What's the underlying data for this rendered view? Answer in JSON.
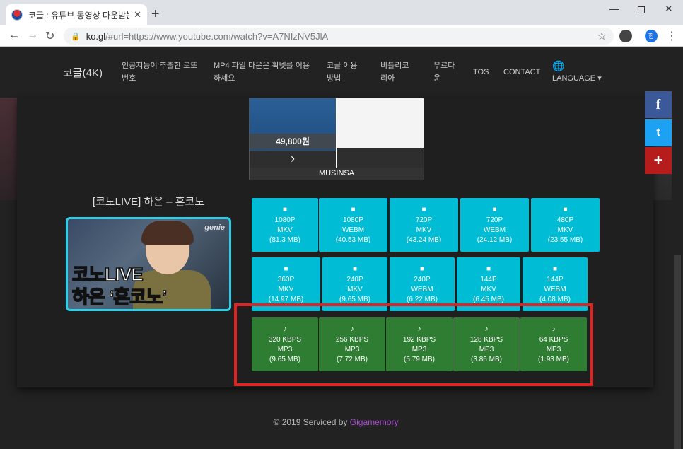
{
  "browser": {
    "tab_title": "코글 : 유튜브 동영상 다운받는법",
    "tab_close": "✕",
    "new_tab": "+",
    "url_host": "ko.gl",
    "url_rest": "/#url=https://www.youtube.com/watch?v=A7NIzNV5JlA",
    "ext_label": "한"
  },
  "nav": {
    "brand": "코글(4K)",
    "items": [
      {
        "line1": "인공지능이 추출한 로또",
        "line2": "번호"
      },
      {
        "line1": "MP4 파일 다운은 휙넷를 이용",
        "line2": "하세요"
      },
      {
        "line1": "코글 이용",
        "line2": "방법"
      },
      {
        "line1": "비틀리코",
        "line2": "리아"
      },
      {
        "line1": "무료다",
        "line2": "운"
      },
      {
        "line1": "TOS",
        "line2": ""
      },
      {
        "line1": "CONTACT",
        "line2": ""
      }
    ],
    "language": "LANGUAGE"
  },
  "ad": {
    "price": "49,800원",
    "footer": "MUSINSA"
  },
  "video": {
    "title": "[코노LIVE] 하은 – 혼코노",
    "thumb_logo": "genie",
    "thumb_line1": "코노LIVE",
    "thumb_line2": "하은 ‘혼코노’"
  },
  "video_buttons": [
    {
      "quality": "1080P",
      "format": "MKV",
      "size": "(81.3 MB)"
    },
    {
      "quality": "1080P",
      "format": "WEBM",
      "size": "(40.53 MB)"
    },
    {
      "quality": "720P",
      "format": "MKV",
      "size": "(43.24 MB)"
    },
    {
      "quality": "720P",
      "format": "WEBM",
      "size": "(24.12 MB)"
    },
    {
      "quality": "480P",
      "format": "MKV",
      "size": "(23.55 MB)"
    },
    {
      "quality": "360P",
      "format": "MKV",
      "size": "(14.97 MB)"
    },
    {
      "quality": "240P",
      "format": "MKV",
      "size": "(9.65 MB)"
    },
    {
      "quality": "240P",
      "format": "WEBM",
      "size": "(6.22 MB)"
    },
    {
      "quality": "144P",
      "format": "MKV",
      "size": "(6.45 MB)"
    },
    {
      "quality": "144P",
      "format": "WEBM",
      "size": "(4.08 MB)"
    }
  ],
  "audio_buttons": [
    {
      "quality": "320 KBPS",
      "format": "MP3",
      "size": "(9.65 MB)"
    },
    {
      "quality": "256 KBPS",
      "format": "MP3",
      "size": "(7.72 MB)"
    },
    {
      "quality": "192 KBPS",
      "format": "MP3",
      "size": "(5.79 MB)"
    },
    {
      "quality": "128 KBPS",
      "format": "MP3",
      "size": "(3.86 MB)"
    },
    {
      "quality": "64 KBPS",
      "format": "MP3",
      "size": "(1.93 MB)"
    }
  ],
  "share": {
    "facebook": "f",
    "twitter": "t",
    "more": "+"
  },
  "footer": {
    "text": "© 2019 Serviced by ",
    "link": "Gigamemory"
  },
  "colors": {
    "video_button": "#00bcd4",
    "audio_button": "#2e7d32",
    "highlight_box": "#e32222"
  }
}
